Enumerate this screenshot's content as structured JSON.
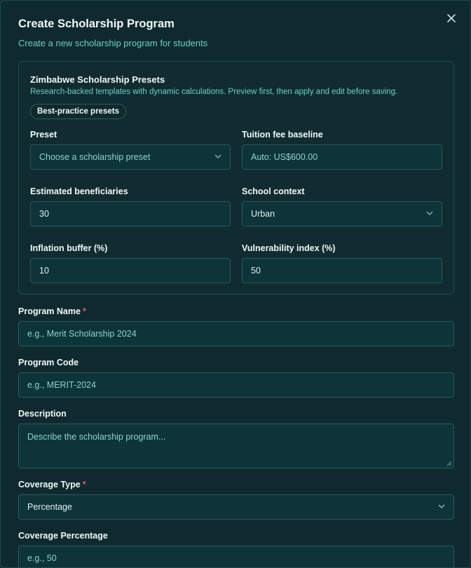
{
  "modal": {
    "title": "Create Scholarship Program",
    "subtitle": "Create a new scholarship program for students",
    "close_icon": "x-icon"
  },
  "presets": {
    "title": "Zimbabwe Scholarship Presets",
    "description": "Research-backed templates with dynamic calculations. Preview first, then apply and edit before saving.",
    "badge": "Best-practice presets",
    "preset": {
      "label": "Preset",
      "placeholder": "Choose a scholarship preset"
    },
    "tuition": {
      "label": "Tuition fee baseline",
      "placeholder": "Auto: US$600.00"
    },
    "beneficiaries": {
      "label": "Estimated beneficiaries",
      "value": "30"
    },
    "school_context": {
      "label": "School context",
      "value": "Urban"
    },
    "inflation": {
      "label": "Inflation buffer (%)",
      "value": "10"
    },
    "vulnerability": {
      "label": "Vulnerability index (%)",
      "value": "50"
    }
  },
  "form": {
    "program_name": {
      "label": "Program Name",
      "required": "*",
      "placeholder": "e.g., Merit Scholarship 2024"
    },
    "program_code": {
      "label": "Program Code",
      "placeholder": "e.g., MERIT-2024"
    },
    "description": {
      "label": "Description",
      "placeholder": "Describe the scholarship program..."
    },
    "coverage_type": {
      "label": "Coverage Type",
      "required": "*",
      "value": "Percentage"
    },
    "coverage_percentage": {
      "label": "Coverage Percentage",
      "placeholder": "e.g., 50"
    }
  },
  "colors": {
    "background": "#0f2a2e",
    "accent": "#67d1c9",
    "required": "#e25b5b"
  }
}
